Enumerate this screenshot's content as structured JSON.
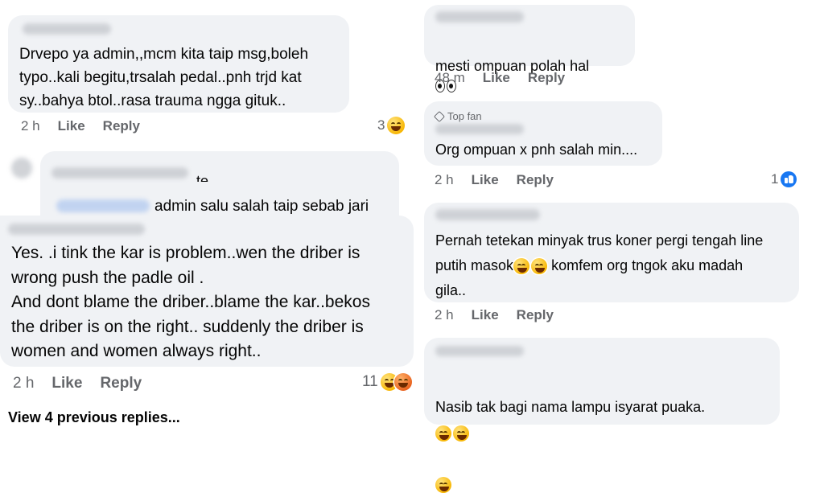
{
  "comments": [
    {
      "id": "c1",
      "text": "Drvepo ya admin,,mcm kita taip msg,boleh\ntypo..kali begitu,trsalah pedal..pnh trjd kat\nsy..bahya btol..rasa trauma ngga gituk..",
      "time": "2 h",
      "like": "Like",
      "reply": "Reply",
      "reactions": "3"
    },
    {
      "id": "c2",
      "text": "admin salu salah taip sebab jari",
      "partial_name": "te"
    },
    {
      "id": "c3",
      "text": "Yes. .i tink the kar is problem..wen the driber is\nwrong push the padle oil .\nAnd dont blame the driber..blame the kar..bekos\nthe driber is on the right.. suddenly the driber is\nwomen and women always right..",
      "time": "2 h",
      "like": "Like",
      "reply": "Reply",
      "reactions": "11"
    },
    {
      "id": "c4",
      "text": "mesti ompuan polah hal",
      "time": "48 m",
      "like": "Like",
      "reply": "Reply"
    },
    {
      "id": "c5",
      "badge": "Top fan",
      "text": "Org ompuan x pnh salah min....",
      "time": "2 h",
      "like": "Like",
      "reply": "Reply",
      "reactions": "1"
    },
    {
      "id": "c6",
      "text": "Pernah tetekan minyak trus koner pergi tengah line\nputih masok",
      "text_tail": " komfem org tngok aku madah\ngila..",
      "time": "2 h",
      "like": "Like",
      "reply": "Reply"
    },
    {
      "id": "c7",
      "text": "Nasib tak bagi nama lampu isyarat puaka."
    }
  ],
  "view_more": "View 4 previous replies...",
  "icons": {
    "laugh": "laughing-emoji-icon",
    "like": "like-badge-icon",
    "eyes": "eyes-emoji-icon",
    "grin": "grinning-emoji-icon",
    "angry": "angry-emoji-icon",
    "top_fan": "diamond-icon"
  },
  "colors": {
    "bubble": "#f0f2f5",
    "meta": "#65676b",
    "like_blue": "#1877f2"
  }
}
